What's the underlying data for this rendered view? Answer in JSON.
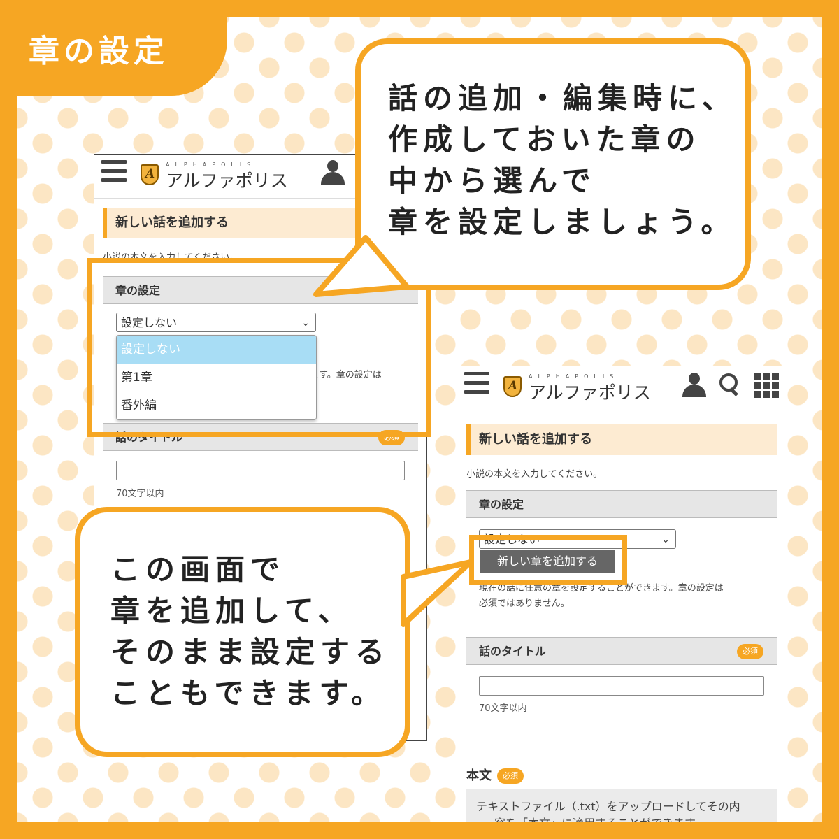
{
  "page_title": "章の設定",
  "colors": {
    "accent": "#F6A623",
    "banner_bg": "#FDEBD2",
    "section_bg": "#E6E6E6",
    "selected_option": "#A8DDF5",
    "button": "#666666"
  },
  "callout_top": {
    "lines": [
      "話の追加・編集時に、",
      "作成しておいた章の",
      "中から選んで",
      "章を設定しましょう。"
    ]
  },
  "callout_bottom": {
    "lines": [
      "この画面で",
      "章を追加して、",
      "そのまま設定する",
      "こともできます。"
    ]
  },
  "screen_left": {
    "logo_small": "ALPHAPOLIS",
    "logo_name": "アルファポリス",
    "banner": "新しい話を追加する",
    "note": "小説の本文を入力してください。",
    "chapter_section": "章の設定",
    "select_value": "設定しない",
    "options": [
      "設定しない",
      "第1章",
      "番外編"
    ],
    "partial_note": "ます。章の設定は",
    "title_section": "話のタイトル",
    "required": "必須",
    "title_hint": "70文字以内"
  },
  "screen_right": {
    "logo_small": "ALPHAPOLIS",
    "logo_name": "アルファポリス",
    "banner": "新しい話を追加する",
    "note": "小説の本文を入力してください。",
    "chapter_section": "章の設定",
    "select_value": "設定しない",
    "add_chapter_button": "新しい章を追加する",
    "chapter_note_line1": "現在の話に任意の章を設定することができます。章の設定は",
    "chapter_note_line2": "必須ではありません。",
    "title_section": "話のタイトル",
    "required": "必須",
    "title_hint": "70文字以内",
    "body_label": "本文",
    "body_note_line1": "テキストファイル（.txt）をアップロードしてその内",
    "body_note_line2": "容を「本文」に適用することができます。"
  }
}
